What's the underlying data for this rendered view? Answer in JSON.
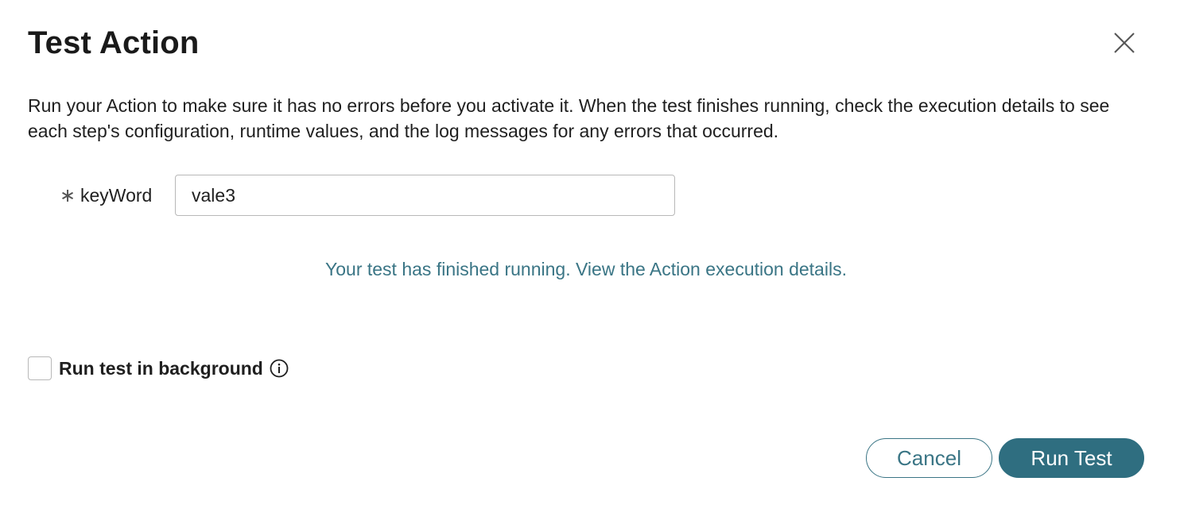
{
  "dialog": {
    "title": "Test Action",
    "close_icon": "close-icon",
    "description": "Run your Action to make sure it has no errors before you activate it. When the test finishes running, check the execution details to see each step's configuration, runtime values, and the log messages for any errors that occurred."
  },
  "form": {
    "keyword": {
      "required_mark": "∗",
      "label": "keyWord",
      "value": "vale3"
    }
  },
  "status": {
    "prefix": "Your test has finished running.",
    "link": "View the Action execution details."
  },
  "background_option": {
    "label": "Run test in background",
    "checked": false,
    "info_icon": "info-icon"
  },
  "actions": {
    "cancel_label": "Cancel",
    "run_label": "Run Test"
  },
  "colors": {
    "accent": "#2f6e80",
    "link": "#3a7585",
    "border": "#b8b8b8"
  }
}
